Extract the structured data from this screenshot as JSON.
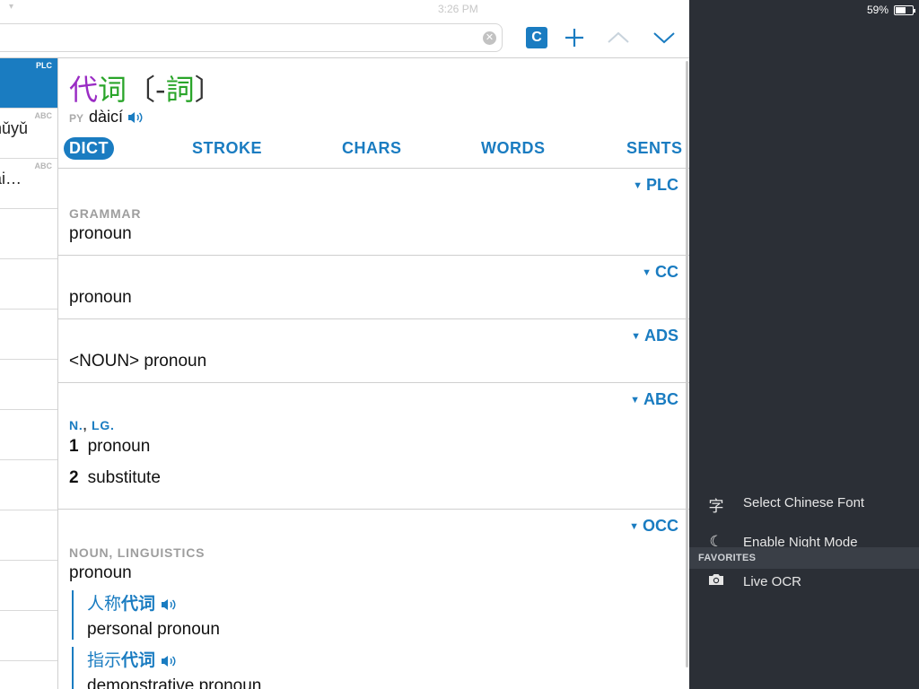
{
  "status": {
    "time": "3:26 PM",
    "battery": "59%",
    "battery_level": 0.59
  },
  "search": {
    "value": "",
    "placeholder": ""
  },
  "toolbar": {
    "c_button_label": "C"
  },
  "list": [
    {
      "text": "",
      "tag": "PLC",
      "active": true
    },
    {
      "text": "nǔyǔ",
      "tag": "ABC",
      "active": false
    },
    {
      "text": "ài…",
      "tag": "ABC",
      "active": false
    },
    {
      "text": "",
      "tag": "",
      "active": false
    },
    {
      "text": "",
      "tag": "",
      "active": false
    },
    {
      "text": "",
      "tag": "",
      "active": false
    },
    {
      "text": "",
      "tag": "",
      "active": false
    },
    {
      "text": "",
      "tag": "",
      "active": false
    },
    {
      "text": "",
      "tag": "",
      "active": false
    },
    {
      "text": "",
      "tag": "",
      "active": false
    },
    {
      "text": "",
      "tag": "",
      "active": false
    },
    {
      "text": "",
      "tag": "",
      "active": false
    },
    {
      "text": "",
      "tag": "",
      "active": false
    }
  ],
  "entry": {
    "hw_char1": "代",
    "hw_char2": "词",
    "hw_open": "〔-",
    "hw_trad": "詞",
    "hw_close": "〕",
    "py_label": "PY",
    "pinyin": "dàicí"
  },
  "tabs": [
    "DICT",
    "STROKE",
    "CHARS",
    "WORDS",
    "SENTS"
  ],
  "sections": {
    "plc": {
      "source": "PLC",
      "label": "GRAMMAR",
      "def": "pronoun"
    },
    "cc": {
      "source": "CC",
      "def": "pronoun"
    },
    "ads": {
      "source": "ADS",
      "def": "<NOUN> pronoun"
    },
    "abc": {
      "source": "ABC",
      "label_a": "N.",
      "label_sep": ", ",
      "label_b": "LG.",
      "defs": [
        {
          "num": "1",
          "text": "pronoun"
        },
        {
          "num": "2",
          "text": "substitute"
        }
      ]
    },
    "occ": {
      "source": "OCC",
      "label": "NOUN, LINGUISTICS",
      "def": "pronoun",
      "examples": [
        {
          "zh_pre": "人称",
          "zh_hl": "代词",
          "en": "personal pronoun"
        },
        {
          "zh_pre": "指示",
          "zh_hl": "代词",
          "en": "demonstrative pronoun"
        }
      ]
    }
  },
  "panel": {
    "items": [
      {
        "icon": "字",
        "label": "Select Chinese Font"
      },
      {
        "icon": "☾",
        "label": "Enable Night Mode"
      }
    ],
    "fav_header": "FAVORITES",
    "fav_items": [
      {
        "label": "Live OCR"
      }
    ]
  },
  "colors": {
    "accent": "#1a7cc1",
    "panel_bg": "#2b2f36",
    "tone4": "#9a2cc4",
    "tone2": "#2aa52a"
  }
}
